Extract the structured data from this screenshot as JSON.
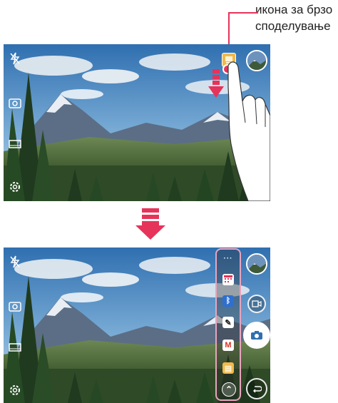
{
  "callout": {
    "line1": "икона за брзо",
    "line2": "споделување"
  },
  "colors": {
    "accent": "#e6335a",
    "highlight_border": "#e9a4be",
    "arrow": "#e6335a"
  },
  "screens": {
    "top": {
      "left_icons": [
        "flash-off-icon",
        "switch-camera-icon",
        "mode-icon",
        "settings-icon"
      ],
      "right_controls": [
        "gallery-thumbnail",
        "video-record-icon",
        "back-icon"
      ],
      "gesture": "drag-down"
    },
    "bottom": {
      "left_icons": [
        "flash-off-icon",
        "switch-camera-icon",
        "mode-icon",
        "settings-icon"
      ],
      "right_controls": [
        "gallery-thumbnail",
        "video-record-icon",
        "shutter-icon",
        "back-icon"
      ],
      "share_panel": {
        "items": [
          {
            "name": "more-icon",
            "glyph": "···"
          },
          {
            "name": "calendar-app-icon",
            "glyph": ""
          },
          {
            "name": "bluetooth-icon",
            "glyph": "ᛒ"
          },
          {
            "name": "edit-app-icon",
            "glyph": "✎"
          },
          {
            "name": "gmail-icon",
            "glyph": "M"
          },
          {
            "name": "message-app-icon",
            "glyph": "▤"
          },
          {
            "name": "collapse-icon",
            "glyph": "⌃"
          }
        ]
      }
    }
  }
}
